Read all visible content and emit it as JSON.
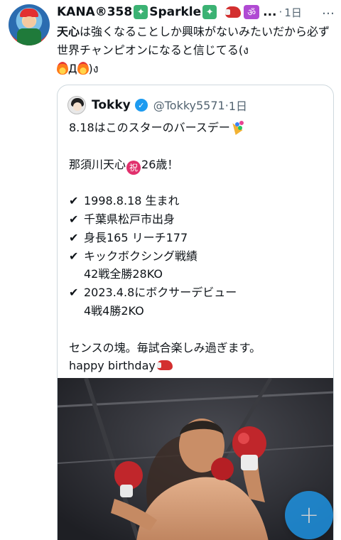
{
  "tweet": {
    "author_name": "KANA®358",
    "sparkle_text": "Sparkle",
    "ellipsis": "...",
    "time_separator": "·",
    "time": "1日",
    "more_label": "…",
    "text_bold": "天心",
    "text_part1": "は強くなることしか興味がないみたいだから必ず世界チャンピオンになると信じてる(ง",
    "text_part2": "Д",
    "text_part3": ")ง"
  },
  "quote": {
    "author_name": "Tokky",
    "handle": "@Tokky5571",
    "time_separator": "·",
    "time": "1日",
    "line1": "8.18はこのスターのバースデー",
    "line2_a": "那須川天心",
    "line2_badge": "祝",
    "line2_b": "26歳！",
    "check": "✔",
    "item1": "1998.8.18 生まれ",
    "item2": "千葉県松戸市出身",
    "item3": "身長165 リーチ177",
    "item4": "キックボクシング戦績",
    "item4_sub": "42戦全勝28KO",
    "item5": "2023.4.8にボクサーデビュー",
    "item5_sub": "4戦4勝2KO",
    "closing1": "センスの塊。毎試合楽しみ過ぎます。",
    "closing2": "happy birthday"
  },
  "fab": {
    "label": "+"
  },
  "colors": {
    "accent": "#1d9bf0",
    "text": "#0f1419",
    "muted": "#536471",
    "border": "#cfd9de"
  },
  "icons": [
    "sparkle-icon",
    "boxing-glove-icon",
    "om-icon",
    "fire-icon",
    "verified-badge-icon",
    "party-popper-icon",
    "celebration-badge-icon",
    "plus-icon"
  ]
}
